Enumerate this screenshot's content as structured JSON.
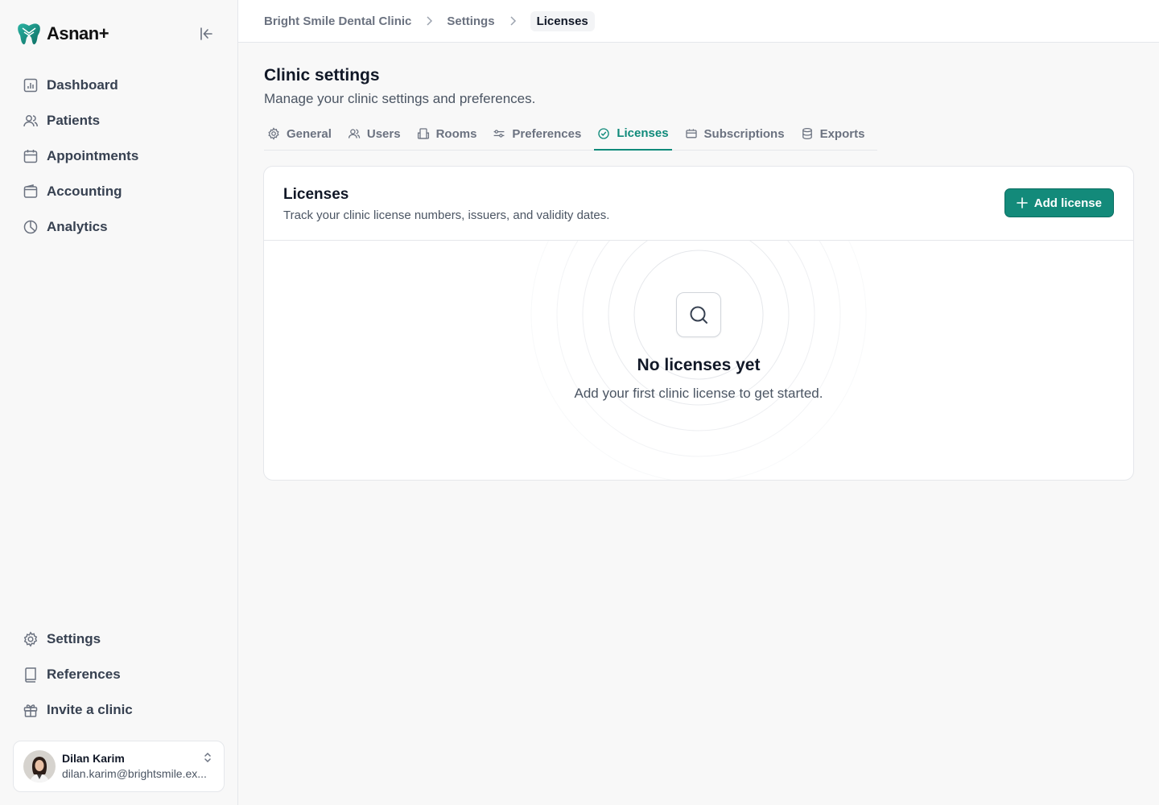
{
  "brand": {
    "name": "Asnan+",
    "logo_icon": "tooth-logo-icon",
    "accent": "#138a7a"
  },
  "sidebar": {
    "top_items": [
      {
        "label": "Dashboard",
        "icon": "chart-icon"
      },
      {
        "label": "Patients",
        "icon": "users-icon"
      },
      {
        "label": "Appointments",
        "icon": "calendar-icon"
      },
      {
        "label": "Accounting",
        "icon": "wallet-icon"
      },
      {
        "label": "Analytics",
        "icon": "pie-chart-icon"
      }
    ],
    "bottom_items": [
      {
        "label": "Settings",
        "icon": "gear-icon"
      },
      {
        "label": "References",
        "icon": "book-icon"
      },
      {
        "label": "Invite a clinic",
        "icon": "gift-icon"
      }
    ],
    "user": {
      "name": "Dilan Karim",
      "email": "dilan.karim@brightsmile.ex..."
    }
  },
  "breadcrumb": {
    "items": [
      "Bright Smile Dental Clinic",
      "Settings"
    ],
    "current": "Licenses"
  },
  "page": {
    "title": "Clinic settings",
    "subtitle": "Manage your clinic settings and preferences."
  },
  "tabs": [
    {
      "label": "General",
      "icon": "gear-icon",
      "active": false
    },
    {
      "label": "Users",
      "icon": "users-icon",
      "active": false
    },
    {
      "label": "Rooms",
      "icon": "building-icon",
      "active": false
    },
    {
      "label": "Preferences",
      "icon": "sliders-icon",
      "active": false
    },
    {
      "label": "Licenses",
      "icon": "check-badge-icon",
      "active": true
    },
    {
      "label": "Subscriptions",
      "icon": "ticket-icon",
      "active": false
    },
    {
      "label": "Exports",
      "icon": "database-icon",
      "active": false
    }
  ],
  "card": {
    "title": "Licenses",
    "description": "Track your clinic license numbers, issuers, and validity dates.",
    "add_button": "Add license",
    "empty_title": "No licenses yet",
    "empty_description": "Add your first clinic license to get started."
  }
}
